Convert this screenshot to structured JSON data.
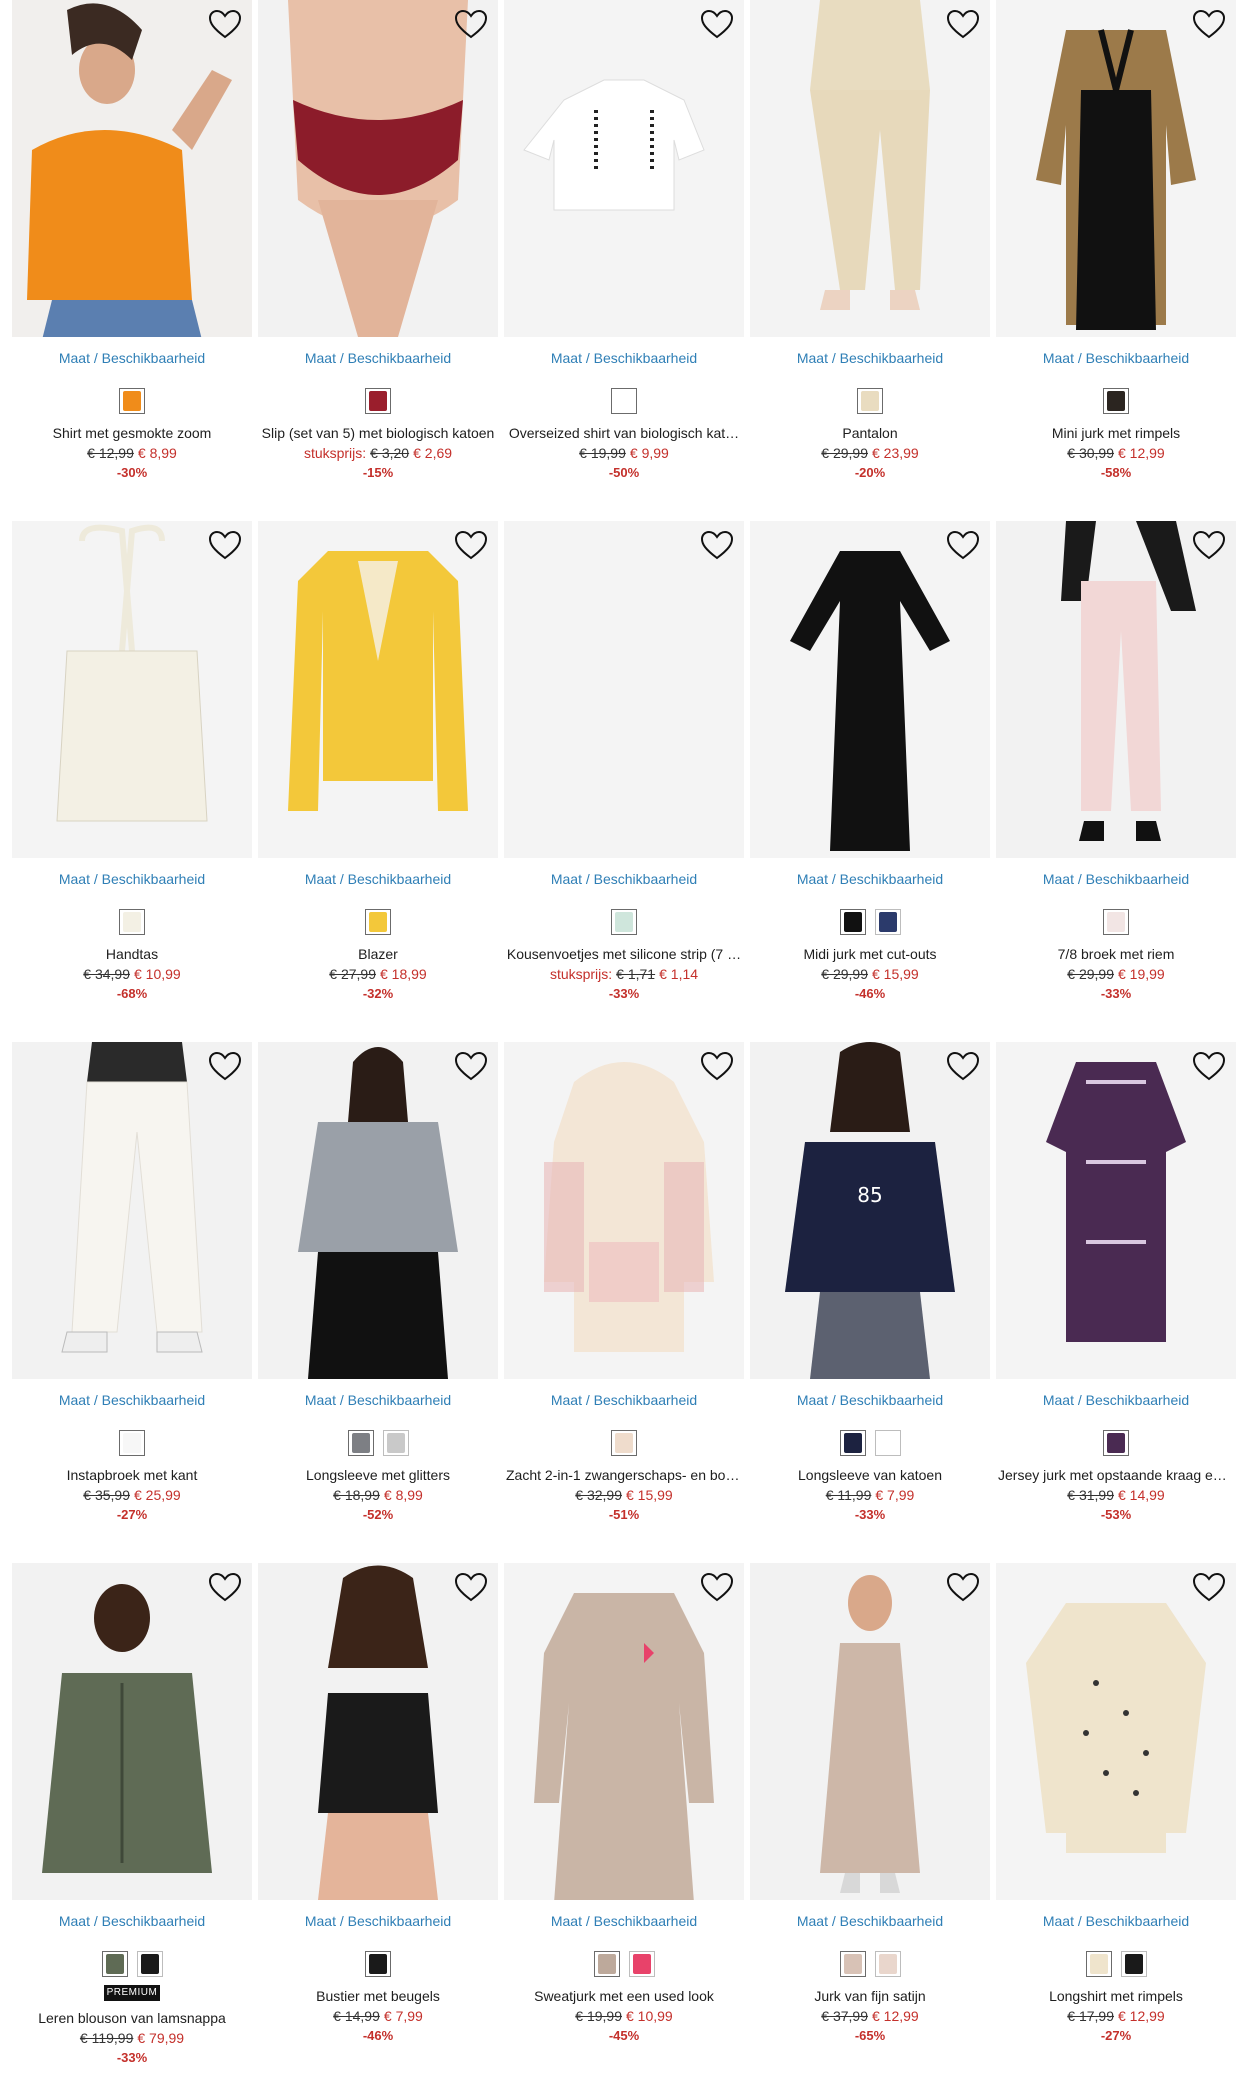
{
  "availability_label": "Maat / Beschikbaarheid",
  "unit_price_label": "stuksprijs:",
  "premium_badge": "PREMIUM",
  "colors": {
    "price_red": "#c4302b",
    "link_blue": "#2f7fb6"
  },
  "products": [
    {
      "title": "Shirt met gesmokte zoom",
      "old_price": "€ 12,99",
      "price": "€ 8,99",
      "discount": "-30%",
      "unit_price": false,
      "premium": false,
      "image_bg": "#f1efed",
      "swatches": [
        "#f08c1a"
      ],
      "image": "orange top on model with denim skirt"
    },
    {
      "title": "Slip (set van 5) met biologisch katoen",
      "old_price": "€ 3,20",
      "price": "€ 2,69",
      "discount": "-15%",
      "unit_price": true,
      "premium": false,
      "image_bg": "#f2f2f2",
      "swatches": [
        "#9a1e2c"
      ],
      "image": "dark red briefs"
    },
    {
      "title": "Overseized shirt van biologisch kat…",
      "old_price": "€ 19,99",
      "price": "€ 9,99",
      "discount": "-50%",
      "unit_price": false,
      "premium": false,
      "image_bg": "#f4f4f4",
      "swatches": [
        "#ffffff"
      ],
      "image": "white cropped t-shirt"
    },
    {
      "title": "Pantalon",
      "old_price": "€ 29,99",
      "price": "€ 23,99",
      "discount": "-20%",
      "unit_price": false,
      "premium": false,
      "image_bg": "#f3f3f3",
      "swatches": [
        "#e9dcc0"
      ],
      "image": "beige trousers"
    },
    {
      "title": "Mini jurk met rimpels",
      "old_price": "€ 30,99",
      "price": "€ 12,99",
      "discount": "-58%",
      "unit_price": false,
      "premium": false,
      "image_bg": "#f4f4f4",
      "swatches": [
        "#2b2520"
      ],
      "image": "black mini dress with leopard sleeves"
    },
    {
      "title": "Handtas",
      "old_price": "€ 34,99",
      "price": "€ 10,99",
      "discount": "-68%",
      "unit_price": false,
      "premium": false,
      "image_bg": "#f4f4f4",
      "swatches": [
        "#f3f0e4"
      ],
      "image": "cream tote bag"
    },
    {
      "title": "Blazer",
      "old_price": "€ 27,99",
      "price": "€ 18,99",
      "discount": "-32%",
      "unit_price": false,
      "premium": false,
      "image_bg": "#f4f4f4",
      "swatches": [
        "#f3c83a"
      ],
      "image": "yellow blazer"
    },
    {
      "title": "Kousenvoetjes met silicone strip (7 …",
      "old_price": "€ 1,71",
      "price": "€ 1,14",
      "discount": "-33%",
      "unit_price": true,
      "premium": false,
      "image_bg": "#f4f4f4",
      "swatches": [
        "#cfe6dc"
      ],
      "image": "empty product image"
    },
    {
      "title": "Midi jurk met cut-outs",
      "old_price": "€ 29,99",
      "price": "€ 15,99",
      "discount": "-46%",
      "unit_price": false,
      "premium": false,
      "image_bg": "#f4f4f4",
      "swatches": [
        "#111111",
        "#2b3a6b"
      ],
      "image": "black midi dress"
    },
    {
      "title": "7/8 broek met riem",
      "old_price": "€ 29,99",
      "price": "€ 19,99",
      "discount": "-33%",
      "unit_price": false,
      "premium": false,
      "image_bg": "#f2f2f2",
      "swatches": [
        "#f2e5e4"
      ],
      "image": "pink trousers with belt"
    },
    {
      "title": "Instapbroek met kant",
      "old_price": "€ 35,99",
      "price": "€ 25,99",
      "discount": "-27%",
      "unit_price": false,
      "premium": false,
      "image_bg": "#f2f2f2",
      "swatches": [
        "#f7f7f7"
      ],
      "image": "white lace trousers"
    },
    {
      "title": "Longsleeve met glitters",
      "old_price": "€ 18,99",
      "price": "€ 8,99",
      "discount": "-52%",
      "unit_price": false,
      "premium": false,
      "image_bg": "#f2f2f2",
      "swatches": [
        "#7d7f84",
        "#c9c9c9"
      ],
      "image": "silver glitter longsleeve"
    },
    {
      "title": "Zacht 2-in-1 zwangerschaps- en bor…",
      "old_price": "€ 32,99",
      "price": "€ 15,99",
      "discount": "-51%",
      "unit_price": false,
      "premium": false,
      "image_bg": "#f4f4f4",
      "swatches": [
        "#efdccc"
      ],
      "image": "floral hoodie"
    },
    {
      "title": "Longsleeve van katoen",
      "old_price": "€ 11,99",
      "price": "€ 7,99",
      "discount": "-33%",
      "unit_price": false,
      "premium": false,
      "image_bg": "#f2f2f2",
      "swatches": [
        "#1c2240",
        "#ffffff"
      ],
      "image": "navy longsleeve 85"
    },
    {
      "title": "Jersey jurk met opstaande kraag en…",
      "old_price": "€ 31,99",
      "price": "€ 14,99",
      "discount": "-53%",
      "unit_price": false,
      "premium": false,
      "image_bg": "#f4f4f4",
      "swatches": [
        "#4a2a52"
      ],
      "image": "purple patterned dress"
    },
    {
      "title": "Leren blouson van lamsnappa",
      "old_price": "€ 119,99",
      "price": "€ 79,99",
      "discount": "-33%",
      "unit_price": false,
      "premium": true,
      "image_bg": "#f2f2f2",
      "swatches": [
        "#5f6b55",
        "#1a1a1a"
      ],
      "image": "olive leather jacket"
    },
    {
      "title": "Bustier met beugels",
      "old_price": "€ 14,99",
      "price": "€ 7,99",
      "discount": "-46%",
      "unit_price": false,
      "premium": false,
      "image_bg": "#f2f2f2",
      "swatches": [
        "#1a1a1a"
      ],
      "image": "black lace bustier"
    },
    {
      "title": "Sweatjurk met een used look",
      "old_price": "€ 19,99",
      "price": "€ 10,99",
      "discount": "-45%",
      "unit_price": false,
      "premium": false,
      "image_bg": "#f4f4f4",
      "swatches": [
        "#bda99b",
        "#e8426a"
      ],
      "image": "taupe sweat dress"
    },
    {
      "title": "Jurk van fijn satijn",
      "old_price": "€ 37,99",
      "price": "€ 12,99",
      "discount": "-65%",
      "unit_price": false,
      "premium": false,
      "image_bg": "#f2f2f2",
      "swatches": [
        "#d8c2b6",
        "#e9d6cc"
      ],
      "image": "champagne satin dress"
    },
    {
      "title": "Longshirt met rimpels",
      "old_price": "€ 17,99",
      "price": "€ 12,99",
      "discount": "-27%",
      "unit_price": false,
      "premium": false,
      "image_bg": "#f4f4f4",
      "swatches": [
        "#efe4cc",
        "#1a1a1a"
      ],
      "image": "floral longshirt"
    }
  ]
}
